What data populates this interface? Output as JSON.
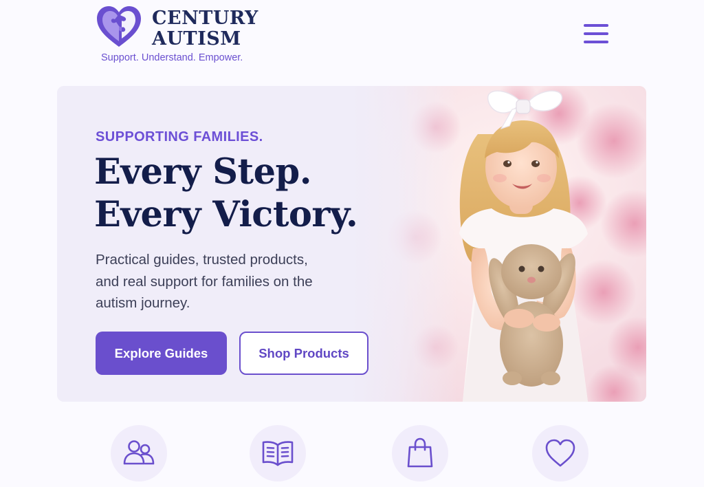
{
  "brand": {
    "name_line1": "CENTURY",
    "name_line2": "AUTISM",
    "tagline": "Support. Understand. Empower.",
    "logo_icon": "puzzle-heart-icon"
  },
  "header": {
    "menu_icon": "hamburger-menu-icon"
  },
  "hero": {
    "eyebrow": "SUPPORTING FAMILIES.",
    "headline_line1": "Every Step.",
    "headline_line2": "Every Victory.",
    "subtext": "Practical guides, trusted products, and real support for families on the autism journey.",
    "primary_button": "Explore Guides",
    "secondary_button": "Shop Products",
    "image_alt": "Smiling young girl with a white bow holding a plush bunny in front of pink flowers"
  },
  "features": [
    {
      "icon": "people-icon"
    },
    {
      "icon": "open-book-icon"
    },
    {
      "icon": "shopping-bag-icon"
    },
    {
      "icon": "heart-icon"
    }
  ],
  "colors": {
    "accent": "#6a4fcd",
    "heading": "#131d4a",
    "page_bg": "#fbfaff",
    "icon_circle": "#f1edfb"
  }
}
